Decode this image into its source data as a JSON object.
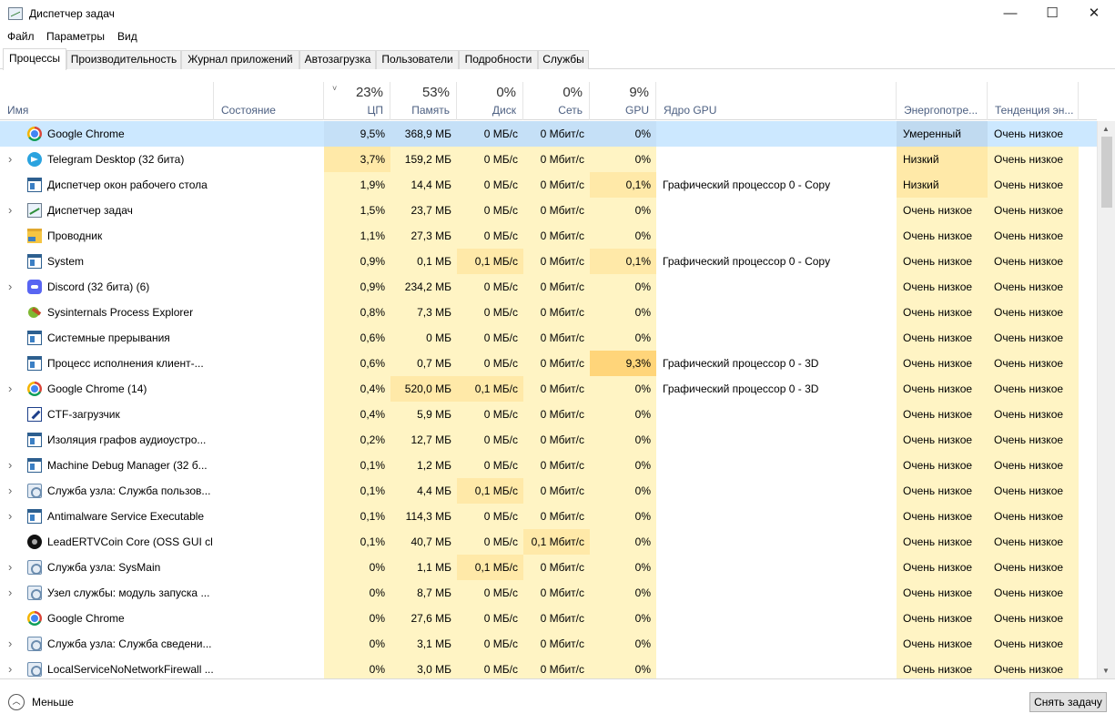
{
  "window": {
    "title": "Диспетчер задач"
  },
  "window_buttons": {
    "minimize": "—",
    "maximize": "☐",
    "close": "✕"
  },
  "menu": [
    "Файл",
    "Параметры",
    "Вид"
  ],
  "tabs": [
    "Процессы",
    "Производительность",
    "Журнал приложений",
    "Автозагрузка",
    "Пользователи",
    "Подробности",
    "Службы"
  ],
  "active_tab": "Процессы",
  "columns": {
    "name": "Имя",
    "status": "Состояние",
    "cpu": {
      "percent": "23%",
      "label": "ЦП"
    },
    "memory": {
      "percent": "53%",
      "label": "Память"
    },
    "disk": {
      "percent": "0%",
      "label": "Диск"
    },
    "network": {
      "percent": "0%",
      "label": "Сеть"
    },
    "gpu": {
      "percent": "9%",
      "label": "GPU"
    },
    "gpu_engine": "Ядро GPU",
    "power": "Энергопотре...",
    "power_trend": "Тенденция эн..."
  },
  "sort_indicator": "˅",
  "colors": {
    "selected_row": "#cce8ff",
    "heat_light": "#fff4c4",
    "heat_medium": "#ffe9a8",
    "heat_strong": "#ffd57a",
    "header_label": "#4d6082"
  },
  "processes": [
    {
      "name": "Google Chrome",
      "icon": "chrome-icon",
      "expandable": false,
      "status": "",
      "cpu": "9,5%",
      "memory": "368,9 МБ",
      "disk": "0 МБ/с",
      "network": "0 Мбит/с",
      "gpu": "0%",
      "gpu_engine": "",
      "power": "Умеренный",
      "power_trend": "Очень низкое",
      "selected": true
    },
    {
      "name": "Telegram Desktop (32 бита)",
      "icon": "telegram-icon",
      "expandable": true,
      "status": "",
      "cpu": "3,7%",
      "memory": "159,2 МБ",
      "disk": "0 МБ/с",
      "network": "0 Мбит/с",
      "gpu": "0%",
      "gpu_engine": "",
      "power": "Низкий",
      "power_trend": "Очень низкое"
    },
    {
      "name": "Диспетчер окон рабочего стола",
      "icon": "window-icon",
      "expandable": false,
      "status": "",
      "cpu": "1,9%",
      "memory": "14,4 МБ",
      "disk": "0 МБ/с",
      "network": "0 Мбит/с",
      "gpu": "0,1%",
      "gpu_engine": "Графический процессор 0 - Copy",
      "power": "Низкий",
      "power_trend": "Очень низкое"
    },
    {
      "name": "Диспетчер задач",
      "icon": "task-manager-icon",
      "expandable": true,
      "status": "",
      "cpu": "1,5%",
      "memory": "23,7 МБ",
      "disk": "0 МБ/с",
      "network": "0 Мбит/с",
      "gpu": "0%",
      "gpu_engine": "",
      "power": "Очень низкое",
      "power_trend": "Очень низкое"
    },
    {
      "name": "Проводник",
      "icon": "folder-icon",
      "expandable": false,
      "status": "",
      "cpu": "1,1%",
      "memory": "27,3 МБ",
      "disk": "0 МБ/с",
      "network": "0 Мбит/с",
      "gpu": "0%",
      "gpu_engine": "",
      "power": "Очень низкое",
      "power_trend": "Очень низкое"
    },
    {
      "name": "System",
      "icon": "window-icon",
      "expandable": false,
      "status": "",
      "cpu": "0,9%",
      "memory": "0,1 МБ",
      "disk": "0,1 МБ/с",
      "network": "0 Мбит/с",
      "gpu": "0,1%",
      "gpu_engine": "Графический процессор 0 - Copy",
      "power": "Очень низкое",
      "power_trend": "Очень низкое"
    },
    {
      "name": "Discord (32 бита) (6)",
      "icon": "discord-icon",
      "expandable": true,
      "status": "",
      "cpu": "0,9%",
      "memory": "234,2 МБ",
      "disk": "0 МБ/с",
      "network": "0 Мбит/с",
      "gpu": "0%",
      "gpu_engine": "",
      "power": "Очень низкое",
      "power_trend": "Очень низкое"
    },
    {
      "name": "Sysinternals Process Explorer",
      "icon": "process-explorer-icon",
      "expandable": false,
      "status": "",
      "cpu": "0,8%",
      "memory": "7,3 МБ",
      "disk": "0 МБ/с",
      "network": "0 Мбит/с",
      "gpu": "0%",
      "gpu_engine": "",
      "power": "Очень низкое",
      "power_trend": "Очень низкое"
    },
    {
      "name": "Системные прерывания",
      "icon": "window-icon",
      "expandable": false,
      "status": "",
      "cpu": "0,6%",
      "memory": "0 МБ",
      "disk": "0 МБ/с",
      "network": "0 Мбит/с",
      "gpu": "0%",
      "gpu_engine": "",
      "power": "Очень низкое",
      "power_trend": "Очень низкое"
    },
    {
      "name": "Процесс исполнения клиент-...",
      "icon": "window-icon",
      "expandable": false,
      "status": "",
      "cpu": "0,6%",
      "memory": "0,7 МБ",
      "disk": "0 МБ/с",
      "network": "0 Мбит/с",
      "gpu": "9,3%",
      "gpu_engine": "Графический процессор 0 - 3D",
      "power": "Очень низкое",
      "power_trend": "Очень низкое"
    },
    {
      "name": "Google Chrome (14)",
      "icon": "chrome-icon",
      "expandable": true,
      "status": "",
      "cpu": "0,4%",
      "memory": "520,0 МБ",
      "disk": "0,1 МБ/с",
      "network": "0 Мбит/с",
      "gpu": "0%",
      "gpu_engine": "Графический процессор 0 - 3D",
      "power": "Очень низкое",
      "power_trend": "Очень низкое"
    },
    {
      "name": "CTF-загрузчик",
      "icon": "ctf-loader-icon",
      "expandable": false,
      "status": "",
      "cpu": "0,4%",
      "memory": "5,9 МБ",
      "disk": "0 МБ/с",
      "network": "0 Мбит/с",
      "gpu": "0%",
      "gpu_engine": "",
      "power": "Очень низкое",
      "power_trend": "Очень низкое"
    },
    {
      "name": "Изоляция графов аудиоустро...",
      "icon": "window-icon",
      "expandable": false,
      "status": "",
      "cpu": "0,2%",
      "memory": "12,7 МБ",
      "disk": "0 МБ/с",
      "network": "0 Мбит/с",
      "gpu": "0%",
      "gpu_engine": "",
      "power": "Очень низкое",
      "power_trend": "Очень низкое"
    },
    {
      "name": "Machine Debug Manager (32 б...",
      "icon": "window-icon",
      "expandable": true,
      "status": "",
      "cpu": "0,1%",
      "memory": "1,2 МБ",
      "disk": "0 МБ/с",
      "network": "0 Мбит/с",
      "gpu": "0%",
      "gpu_engine": "",
      "power": "Очень низкое",
      "power_trend": "Очень низкое"
    },
    {
      "name": "Служба узла: Служба пользов...",
      "icon": "service-gear-icon",
      "expandable": true,
      "status": "",
      "cpu": "0,1%",
      "memory": "4,4 МБ",
      "disk": "0,1 МБ/с",
      "network": "0 Мбит/с",
      "gpu": "0%",
      "gpu_engine": "",
      "power": "Очень низкое",
      "power_trend": "Очень низкое"
    },
    {
      "name": "Antimalware Service Executable",
      "icon": "window-icon",
      "expandable": true,
      "status": "",
      "cpu": "0,1%",
      "memory": "114,3 МБ",
      "disk": "0 МБ/с",
      "network": "0 Мбит/с",
      "gpu": "0%",
      "gpu_engine": "",
      "power": "Очень низкое",
      "power_trend": "Очень низкое"
    },
    {
      "name": "LeadERTVCoin Core (OSS GUI cli...",
      "icon": "coin-icon",
      "expandable": false,
      "status": "",
      "cpu": "0,1%",
      "memory": "40,7 МБ",
      "disk": "0 МБ/с",
      "network": "0,1 Мбит/с",
      "gpu": "0%",
      "gpu_engine": "",
      "power": "Очень низкое",
      "power_trend": "Очень низкое"
    },
    {
      "name": "Служба узла: SysMain",
      "icon": "service-gear-icon",
      "expandable": true,
      "status": "",
      "cpu": "0%",
      "memory": "1,1 МБ",
      "disk": "0,1 МБ/с",
      "network": "0 Мбит/с",
      "gpu": "0%",
      "gpu_engine": "",
      "power": "Очень низкое",
      "power_trend": "Очень низкое"
    },
    {
      "name": "Узел службы: модуль запуска ...",
      "icon": "service-gear-icon",
      "expandable": true,
      "status": "",
      "cpu": "0%",
      "memory": "8,7 МБ",
      "disk": "0 МБ/с",
      "network": "0 Мбит/с",
      "gpu": "0%",
      "gpu_engine": "",
      "power": "Очень низкое",
      "power_trend": "Очень низкое"
    },
    {
      "name": "Google Chrome",
      "icon": "chrome-icon",
      "expandable": false,
      "status": "",
      "cpu": "0%",
      "memory": "27,6 МБ",
      "disk": "0 МБ/с",
      "network": "0 Мбит/с",
      "gpu": "0%",
      "gpu_engine": "",
      "power": "Очень низкое",
      "power_trend": "Очень низкое"
    },
    {
      "name": "Служба узла: Служба сведени...",
      "icon": "service-gear-icon",
      "expandable": true,
      "status": "",
      "cpu": "0%",
      "memory": "3,1 МБ",
      "disk": "0 МБ/с",
      "network": "0 Мбит/с",
      "gpu": "0%",
      "gpu_engine": "",
      "power": "Очень низкое",
      "power_trend": "Очень низкое"
    },
    {
      "name": "LocalServiceNoNetworkFirewall ...",
      "icon": "service-gear-icon",
      "expandable": true,
      "status": "",
      "cpu": "0%",
      "memory": "3,0 МБ",
      "disk": "0 МБ/с",
      "network": "0 Мбит/с",
      "gpu": "0%",
      "gpu_engine": "",
      "power": "Очень низкое",
      "power_trend": "Очень низкое"
    }
  ],
  "footer": {
    "less_label": "Меньше",
    "end_task_label": "Снять задачу"
  }
}
